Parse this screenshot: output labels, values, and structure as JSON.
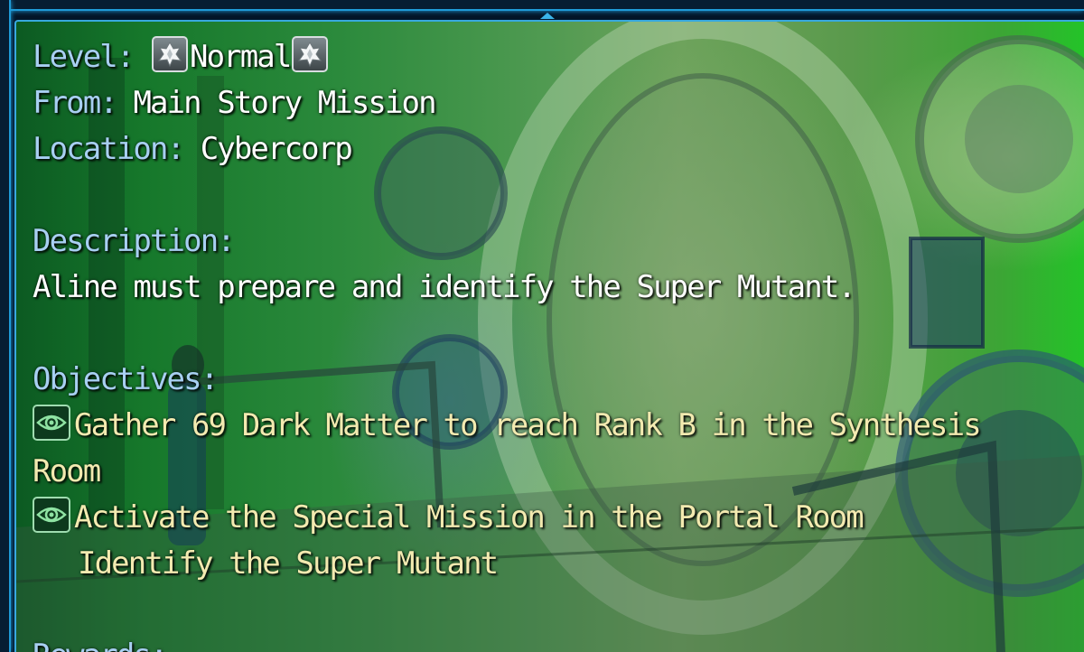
{
  "level": {
    "label": "Level:",
    "value": "Normal",
    "icon": "crystal-icon"
  },
  "from": {
    "label": "From:",
    "value": "Main Story Mission"
  },
  "location": {
    "label": "Location:",
    "value": "Cybercorp"
  },
  "description": {
    "label": "Description:",
    "text": "Aline must prepare and identify the Super Mutant."
  },
  "objectives": {
    "label": "Objectives:",
    "items": [
      {
        "icon": "eye-icon",
        "text_line1": "Gather 69 Dark Matter to reach Rank B in the Synthesis",
        "text_line2": "Room"
      },
      {
        "icon": "eye-icon",
        "text_line1": "Activate the Special Mission in the Portal Room"
      },
      {
        "icon": "",
        "text_line1": "Identify the Super Mutant"
      }
    ]
  },
  "rewards": {
    "label": "Rewards:"
  },
  "colors": {
    "label": "#a8cff2",
    "value": "#ffffff",
    "objective": "#f3eab0",
    "frame": "#1f9bd8"
  }
}
